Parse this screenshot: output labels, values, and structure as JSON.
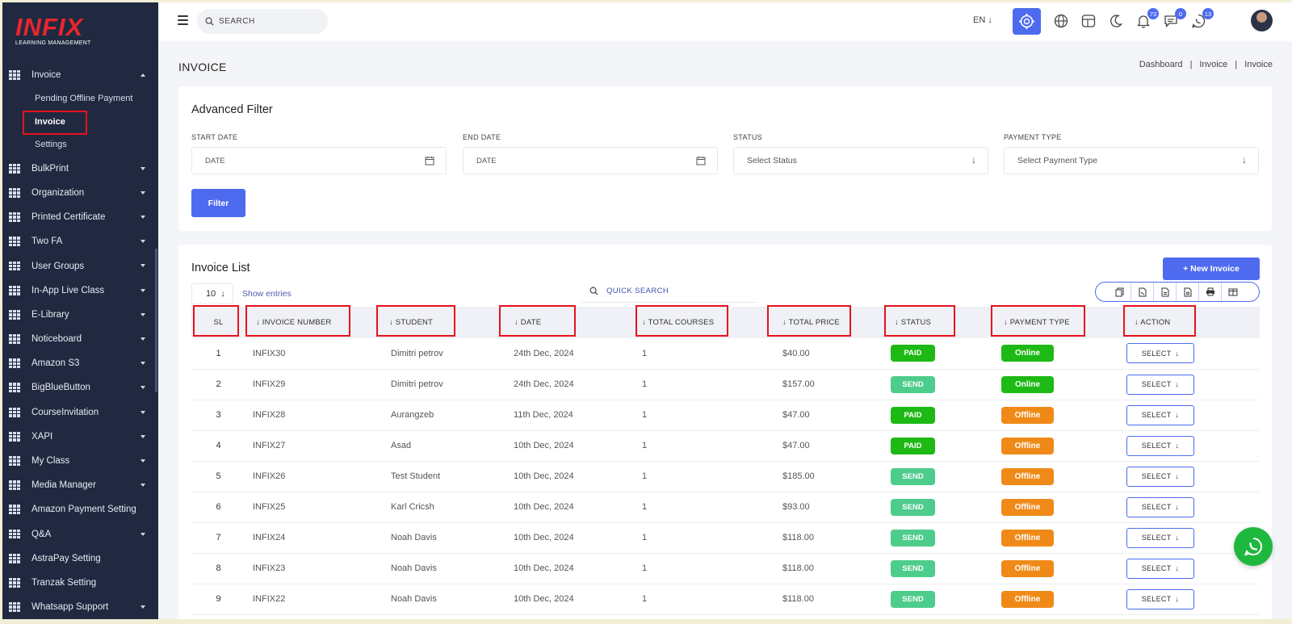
{
  "sidebar": {
    "logo_text": "INFIX",
    "logo_sub": "LEARNING MANAGEMENT",
    "items": [
      {
        "label": "Invoice",
        "expanded": true
      },
      {
        "label": "BulkPrint"
      },
      {
        "label": "Organization"
      },
      {
        "label": "Printed Certificate"
      },
      {
        "label": "Two FA"
      },
      {
        "label": "User Groups"
      },
      {
        "label": "In-App Live Class"
      },
      {
        "label": "E-Library"
      },
      {
        "label": "Noticeboard"
      },
      {
        "label": "Amazon S3"
      },
      {
        "label": "BigBlueButton"
      },
      {
        "label": "CourseInvitation"
      },
      {
        "label": "XAPI"
      },
      {
        "label": "My Class"
      },
      {
        "label": "Media Manager"
      },
      {
        "label": "Amazon Payment Setting"
      },
      {
        "label": "Q&A"
      },
      {
        "label": "AstraPay Setting"
      },
      {
        "label": "Tranzak Setting"
      },
      {
        "label": "Whatsapp Support"
      }
    ],
    "sub_items": [
      "Pending Offline Payment",
      "Invoice",
      "Settings"
    ]
  },
  "header": {
    "search_placeholder": "SEARCH",
    "language": "EN",
    "badges": {
      "notifications": "73",
      "messages": "0",
      "whatsapp": "13"
    }
  },
  "page": {
    "title": "INVOICE",
    "breadcrumb": [
      "Dashboard",
      "Invoice",
      "Invoice"
    ]
  },
  "filter": {
    "title": "Advanced Filter",
    "start_date_label": "START DATE",
    "start_date_placeholder": "DATE",
    "end_date_label": "END DATE",
    "end_date_placeholder": "DATE",
    "status_label": "STATUS",
    "status_value": "Select Status",
    "payment_type_label": "PAYMENT TYPE",
    "payment_type_value": "Select Payment Type",
    "button": "Filter"
  },
  "list": {
    "title": "Invoice List",
    "new_button": "+ New Invoice",
    "page_length": "10",
    "show_entries": "Show entries",
    "quick_search_placeholder": "QUICK SEARCH",
    "columns": [
      "SL",
      "INVOICE NUMBER",
      "STUDENT",
      "DATE",
      "TOTAL COURSES",
      "TOTAL PRICE",
      "STATUS",
      "PAYMENT TYPE",
      "ACTION"
    ],
    "action_label": "SELECT",
    "rows": [
      {
        "sl": "1",
        "invoice": "INFIX30",
        "student": "Dimitri petrov",
        "date": "24th Dec, 2024",
        "courses": "1",
        "price": "$40.00",
        "status": "PAID",
        "payment": "Online"
      },
      {
        "sl": "2",
        "invoice": "INFIX29",
        "student": "Dimitri petrov",
        "date": "24th Dec, 2024",
        "courses": "1",
        "price": "$157.00",
        "status": "SEND",
        "payment": "Online"
      },
      {
        "sl": "3",
        "invoice": "INFIX28",
        "student": "Aurangzeb",
        "date": "11th Dec, 2024",
        "courses": "1",
        "price": "$47.00",
        "status": "PAID",
        "payment": "Offline"
      },
      {
        "sl": "4",
        "invoice": "INFIX27",
        "student": "Asad",
        "date": "10th Dec, 2024",
        "courses": "1",
        "price": "$47.00",
        "status": "PAID",
        "payment": "Offline"
      },
      {
        "sl": "5",
        "invoice": "INFIX26",
        "student": "Test Student",
        "date": "10th Dec, 2024",
        "courses": "1",
        "price": "$185.00",
        "status": "SEND",
        "payment": "Offline"
      },
      {
        "sl": "6",
        "invoice": "INFIX25",
        "student": "Karl Cricsh",
        "date": "10th Dec, 2024",
        "courses": "1",
        "price": "$93.00",
        "status": "SEND",
        "payment": "Offline"
      },
      {
        "sl": "7",
        "invoice": "INFIX24",
        "student": "Noah Davis",
        "date": "10th Dec, 2024",
        "courses": "1",
        "price": "$118.00",
        "status": "SEND",
        "payment": "Offline"
      },
      {
        "sl": "8",
        "invoice": "INFIX23",
        "student": "Noah Davis",
        "date": "10th Dec, 2024",
        "courses": "1",
        "price": "$118.00",
        "status": "SEND",
        "payment": "Offline"
      },
      {
        "sl": "9",
        "invoice": "INFIX22",
        "student": "Noah Davis",
        "date": "10th Dec, 2024",
        "courses": "1",
        "price": "$118.00",
        "status": "SEND",
        "payment": "Offline"
      }
    ]
  },
  "colors": {
    "primary": "#4e6bf0",
    "sidebar": "#202940",
    "paid": "#1db914",
    "send": "#4dcc8b",
    "offline": "#ef8a18",
    "highlight": "#e8111b",
    "whatsapp": "#1fb83f"
  }
}
